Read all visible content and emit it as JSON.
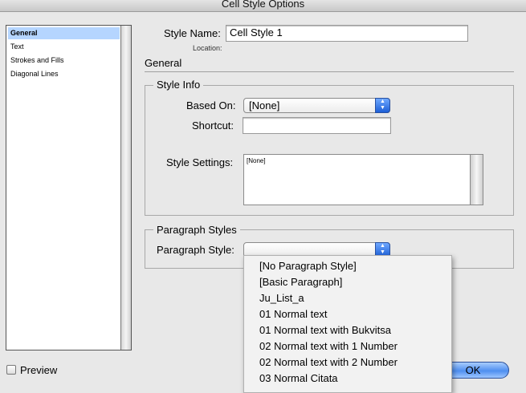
{
  "window": {
    "title": "Cell Style Options"
  },
  "sidebar": {
    "items": [
      {
        "label": "General",
        "selected": true
      },
      {
        "label": "Text"
      },
      {
        "label": "Strokes and Fills"
      },
      {
        "label": "Diagonal Lines"
      }
    ]
  },
  "style_name": {
    "label": "Style Name:",
    "value": "Cell Style 1",
    "location_label": "Location:"
  },
  "section": {
    "title": "General"
  },
  "style_info": {
    "legend": "Style Info",
    "based_on_label": "Based On:",
    "based_on_value": "[None]",
    "shortcut_label": "Shortcut:",
    "shortcut_value": "",
    "settings_label": "Style Settings:",
    "settings_value": "[None]"
  },
  "paragraph_styles": {
    "legend": "Paragraph Styles",
    "style_label": "Paragraph Style:",
    "style_value": "",
    "menu_items": [
      "[No Paragraph Style]",
      "[Basic Paragraph]",
      "Ju_List_a",
      "01 Normal text",
      "01 Normal text with Bukvitsa",
      "02 Normal text with 1 Number",
      "02 Normal text with 2 Number",
      "03 Normal Citata"
    ]
  },
  "footer": {
    "preview_label": "Preview",
    "preview_checked": false,
    "ok_label": "OK"
  },
  "colors": {
    "selection": "#b5d5ff",
    "accent": "#3b7de9"
  }
}
